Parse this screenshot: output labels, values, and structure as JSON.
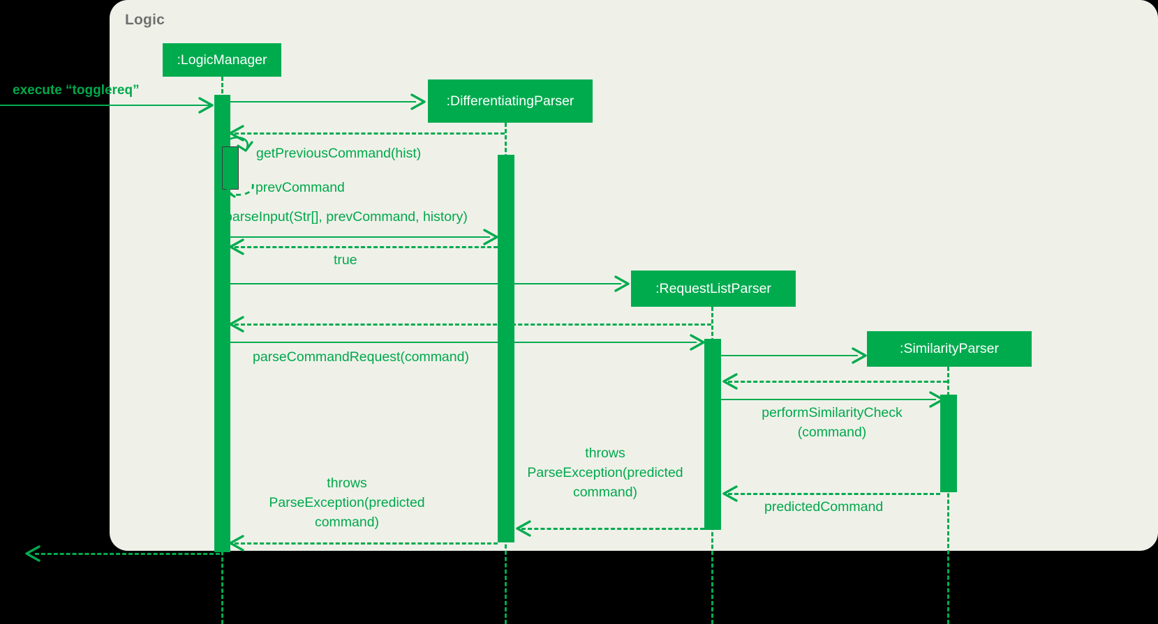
{
  "diagram": {
    "type": "uml-sequence-diagram",
    "panel_title": "Logic",
    "colors": {
      "accent": "#00ab4e",
      "panel_background": "#eff1e9",
      "canvas_background": "#000000",
      "participant_text": "#ffffff",
      "message_text": "#00a84b",
      "panel_title_text": "#6f6f6f"
    }
  },
  "participants": [
    {
      "id": "logicmanager",
      "label": ":LogicManager"
    },
    {
      "id": "differentiatingparser",
      "label": ":DifferentiatingParser"
    },
    {
      "id": "requestlistparser",
      "label": ":RequestListParser"
    },
    {
      "id": "similarityparser",
      "label": ":SimilarityParser"
    }
  ],
  "messages": [
    {
      "id": "m1",
      "label": "execute “togglereq”",
      "kind": "entry-call"
    },
    {
      "id": "m2",
      "label": "",
      "kind": "call"
    },
    {
      "id": "m3",
      "label": "",
      "kind": "return"
    },
    {
      "id": "m4",
      "label": "getPreviousCommand(hist)",
      "kind": "self-call"
    },
    {
      "id": "m5",
      "label": "prevCommand",
      "kind": "self-return"
    },
    {
      "id": "m6",
      "label": "parseInput(Str[], prevCommand, history)",
      "kind": "call"
    },
    {
      "id": "m7",
      "label": "true",
      "kind": "return"
    },
    {
      "id": "m8",
      "label": "",
      "kind": "call"
    },
    {
      "id": "m9",
      "label": "",
      "kind": "return"
    },
    {
      "id": "m10",
      "label": "parseCommandRequest(command)",
      "kind": "call"
    },
    {
      "id": "m11",
      "label": "",
      "kind": "call"
    },
    {
      "id": "m12",
      "label": "",
      "kind": "return"
    },
    {
      "id": "m13",
      "label": "performSimilarityCheck\n(command)",
      "kind": "call"
    },
    {
      "id": "m14",
      "label": "predictedCommand",
      "kind": "return"
    },
    {
      "id": "m15",
      "label": "throws\nParseException(predicted\ncommand)",
      "kind": "return"
    },
    {
      "id": "m16",
      "label": "throws\nParseException(predicted\ncommand)",
      "kind": "return"
    },
    {
      "id": "m17",
      "label": "",
      "kind": "return"
    }
  ],
  "labels": {
    "entry_call": "execute “togglereq”",
    "get_previous_command": "getPreviousCommand(hist)",
    "prev_command": "prevCommand",
    "parse_input": "parseInput(Str[], prevCommand, history)",
    "true_return": "true",
    "parse_command_request": "parseCommandRequest(command)",
    "perform_similarity_check_line1": "performSimilarityCheck",
    "perform_similarity_check_line2": "(command)",
    "predicted_command": "predictedCommand",
    "throws_line1": "throws",
    "throws_line2": "ParseException(predicted",
    "throws_line3": "command)"
  }
}
